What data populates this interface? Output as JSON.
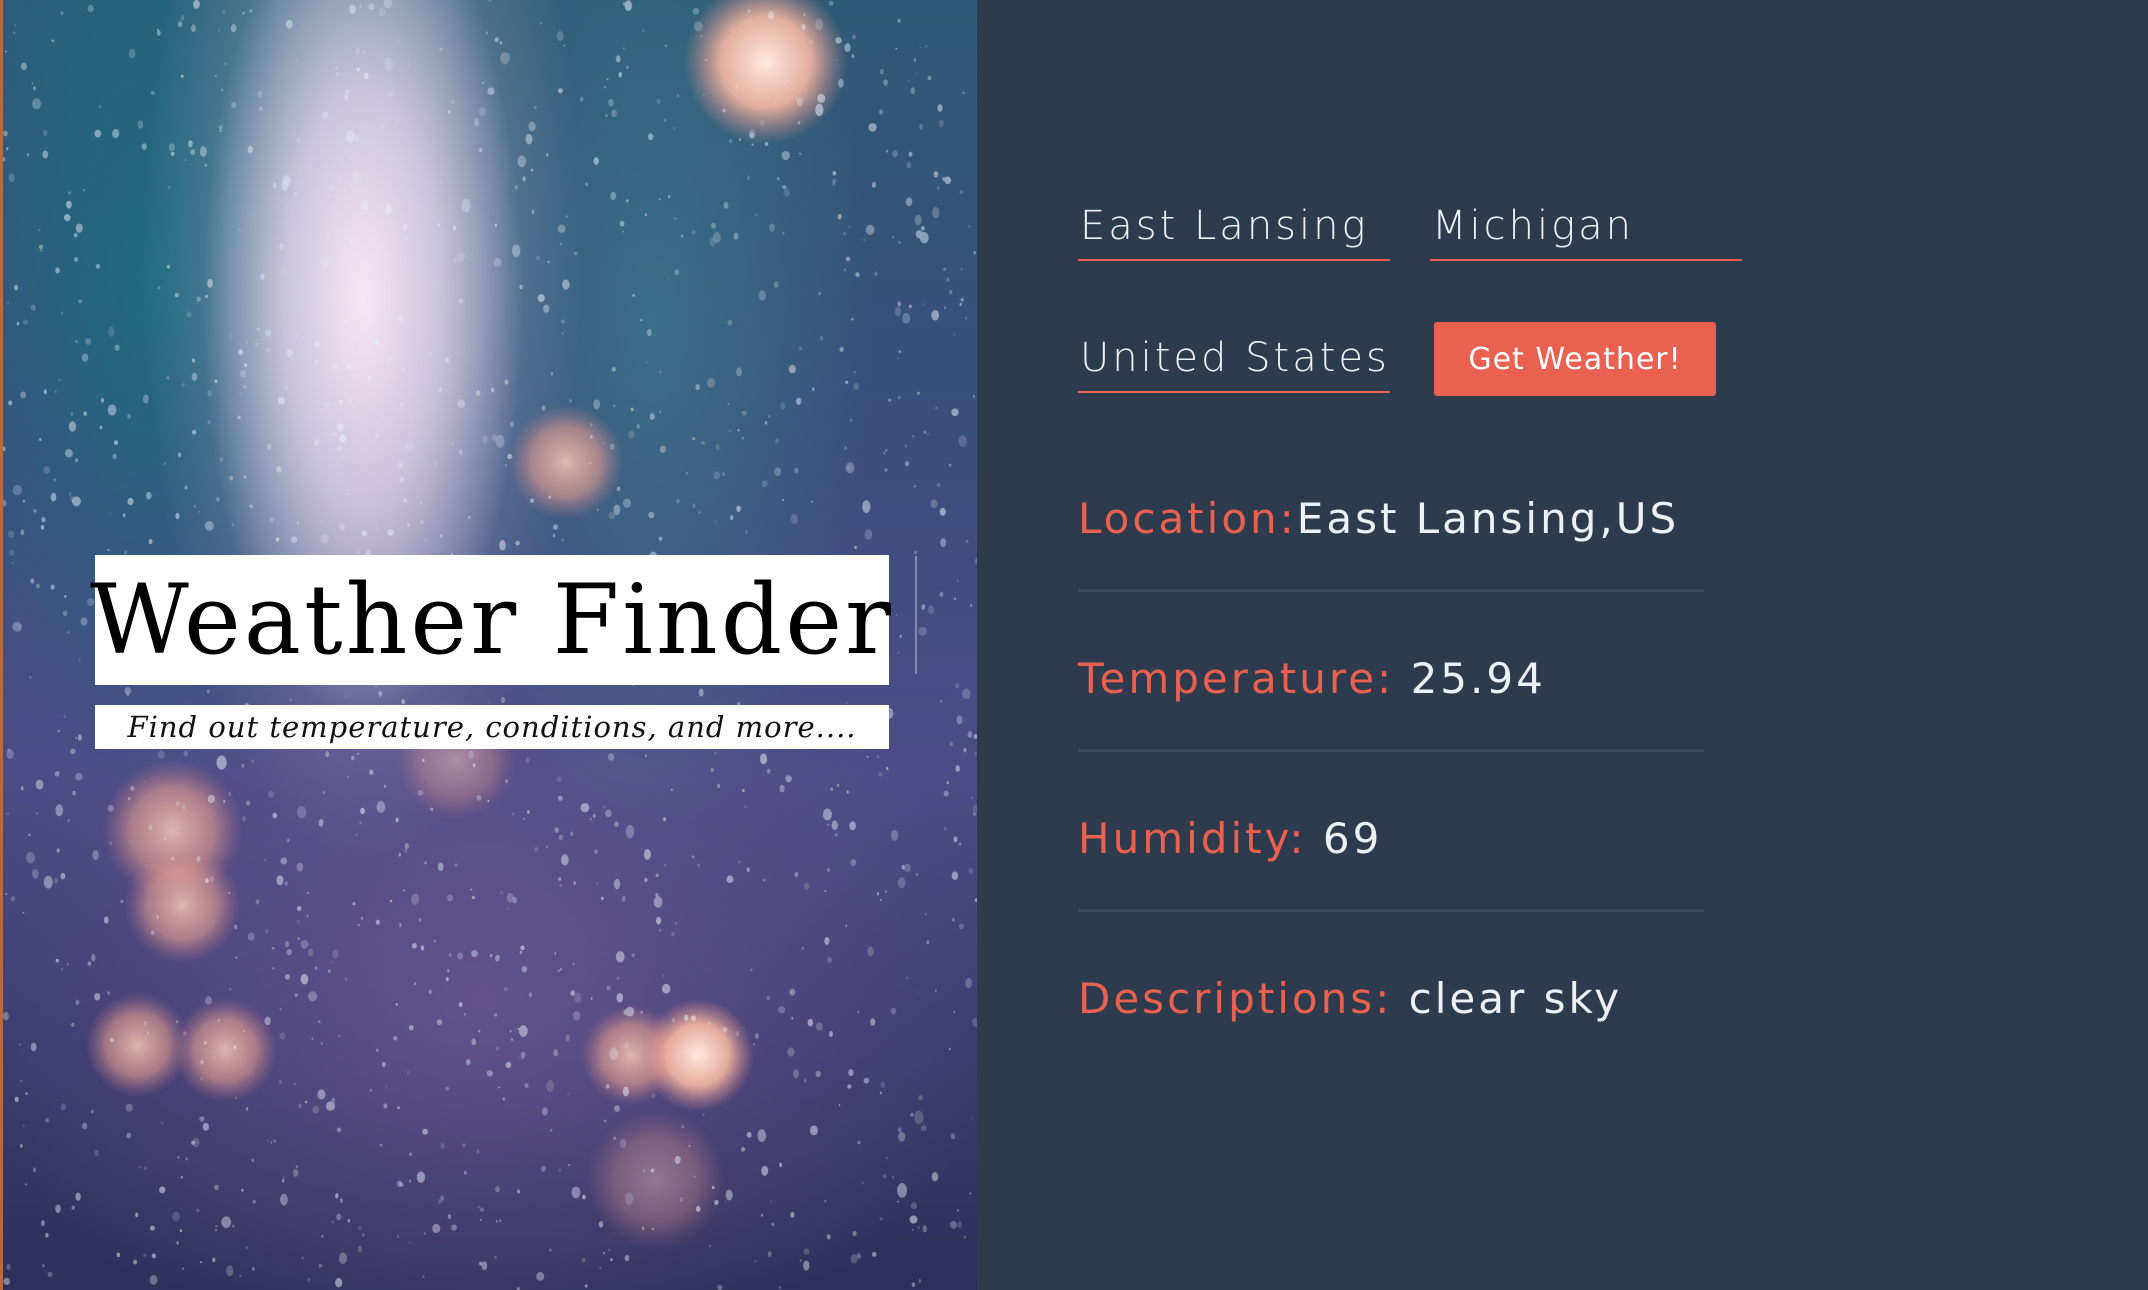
{
  "app": {
    "title": "Weather Finder",
    "subtitle": "Find out temperature, conditions, and more...."
  },
  "form": {
    "city": "East Lansing",
    "state": "Michigan",
    "country": "United States",
    "submit_label": "Get Weather!"
  },
  "results": {
    "location_label": "Location:",
    "location_value": "East Lansing,US",
    "temperature_label": "Temperature:",
    "temperature_value": "25.94",
    "humidity_label": "Humidity:",
    "humidity_value": "69",
    "description_label": "Descriptions:",
    "description_value": "clear sky"
  },
  "colors": {
    "accent": "#ea6051",
    "panel_bg": "#2d3b4d",
    "text": "#eef1f4"
  }
}
